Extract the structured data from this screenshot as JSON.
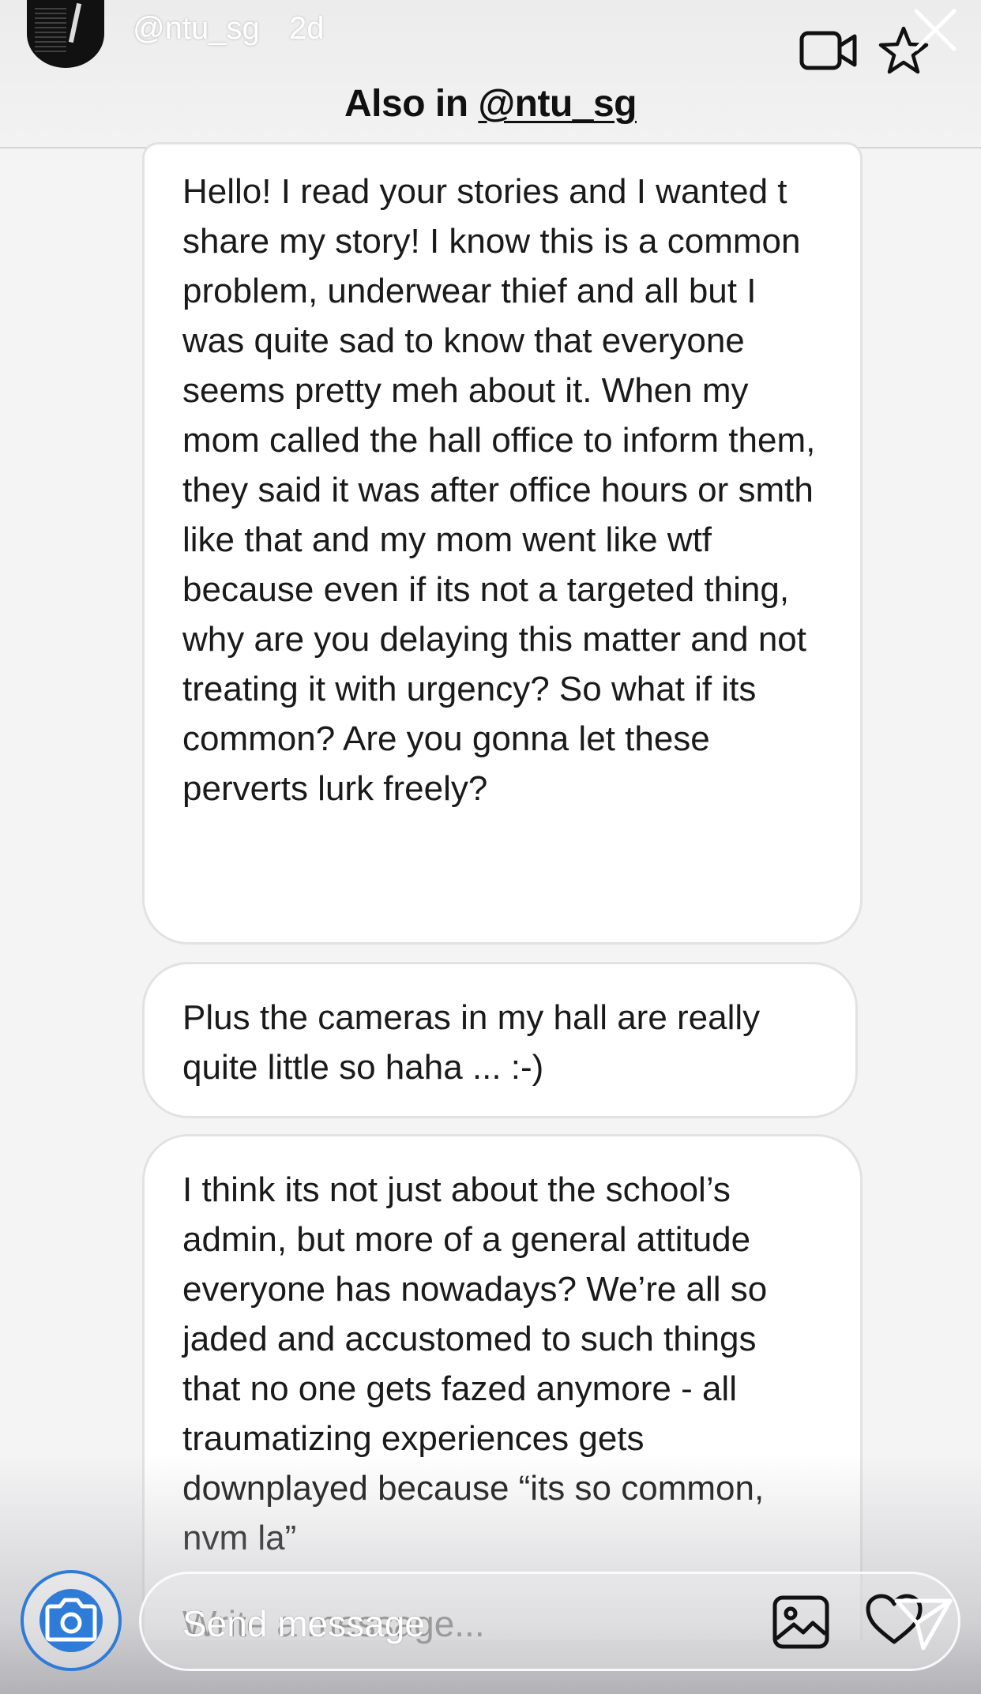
{
  "header": {
    "username": "@ntu_sg",
    "time_ago": "2d",
    "title_prefix": "Also in ",
    "title_account": "@ntu_sg"
  },
  "messages": [
    {
      "text": "Hello! I read your stories and I wanted t share my story! I know this is a common problem, underwear thief and all but I was quite sad to know that everyone seems pretty meh about it. When my mom called the hall office to inform them, they said it was after office hours or smth like that and my mom went like wtf because even if its not a targeted thing, why are you delaying this matter and not treating it with urgency? So what if its common? Are you gonna let these perverts lurk freely?"
    },
    {
      "text": "Plus the cameras in my hall are really quite little so haha ... :-)"
    },
    {
      "text": "I think its not just about the school’s admin, but more of a general attitude everyone has nowadays? We’re all so jaded and accustomed to such things that no one gets fazed anymore - all traumatizing experiences gets downplayed because “its so common, nvm la”"
    }
  ],
  "composer": {
    "placeholder": "Write a message...",
    "send_label": "Send message"
  },
  "icons": {
    "video": "video-camera-icon",
    "star": "star-icon",
    "close": "close-icon",
    "camera": "camera-icon",
    "gallery": "gallery-icon",
    "heart": "heart-icon",
    "send": "send-icon"
  },
  "colors": {
    "accent": "#2e7bd8"
  }
}
